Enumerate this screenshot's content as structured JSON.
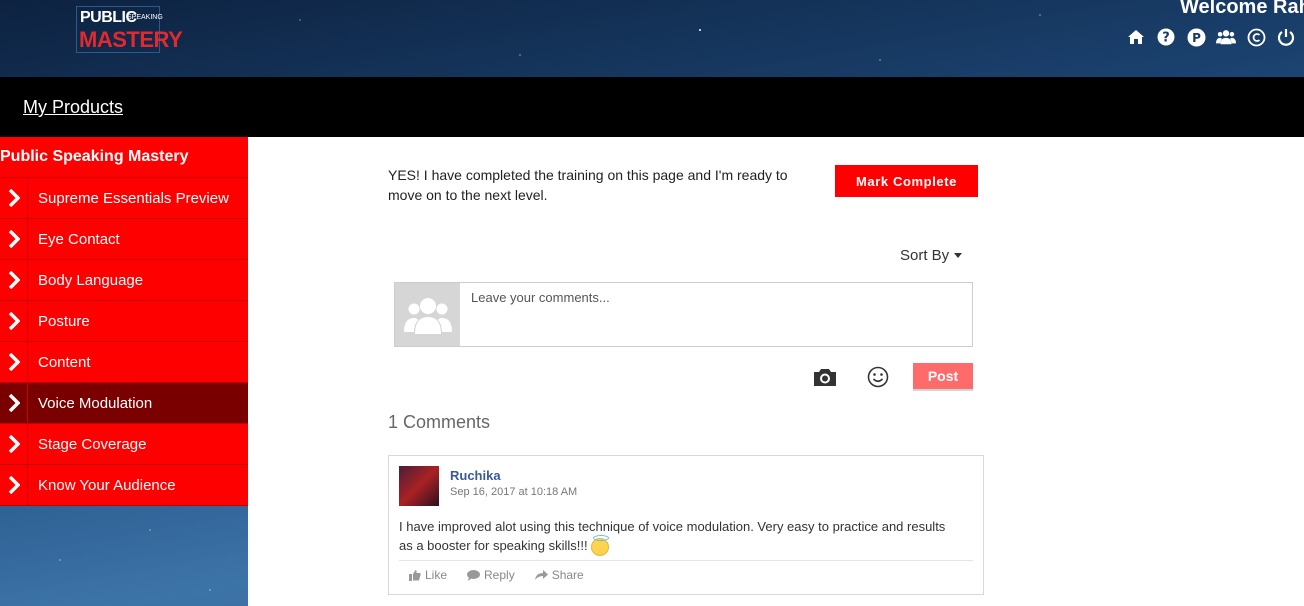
{
  "header": {
    "logo_top": "PUBLIC",
    "logo_small": "SPEAKING",
    "logo_bottom": "MASTERY",
    "welcome": "Welcome Rah",
    "icons": [
      "home-icon",
      "help-icon",
      "p-circle-icon",
      "users-icon",
      "copyright-icon",
      "power-icon"
    ]
  },
  "nav": {
    "my_products": "My Products"
  },
  "sidebar": {
    "title": "Public Speaking Mastery",
    "items": [
      {
        "label": "Supreme Essentials Preview"
      },
      {
        "label": "Eye Contact"
      },
      {
        "label": "Body Language"
      },
      {
        "label": "Posture"
      },
      {
        "label": "Content"
      },
      {
        "label": "Voice Modulation",
        "active": true
      },
      {
        "label": "Stage Coverage"
      },
      {
        "label": "Know Your Audience"
      }
    ]
  },
  "main": {
    "complete_text": "YES! I have completed the training on this page and I'm ready to move on to the next level.",
    "mark_complete": "Mark Complete",
    "sort_by": "Sort By",
    "comment_placeholder": "Leave your comments...",
    "post": "Post",
    "comments_count": "1 Comments"
  },
  "comment": {
    "author": "Ruchika",
    "date": "Sep 16, 2017 at 10:18 AM",
    "text": "I have improved alot using this technique of voice modulation. Very easy to practice and results as a booster for speaking skills!!! ",
    "like": "Like",
    "reply": "Reply",
    "share": "Share"
  },
  "colors": {
    "accent": "#ff0000",
    "active_item": "#7a0000",
    "post": "#ff6b6b",
    "author": "#3b5998"
  }
}
